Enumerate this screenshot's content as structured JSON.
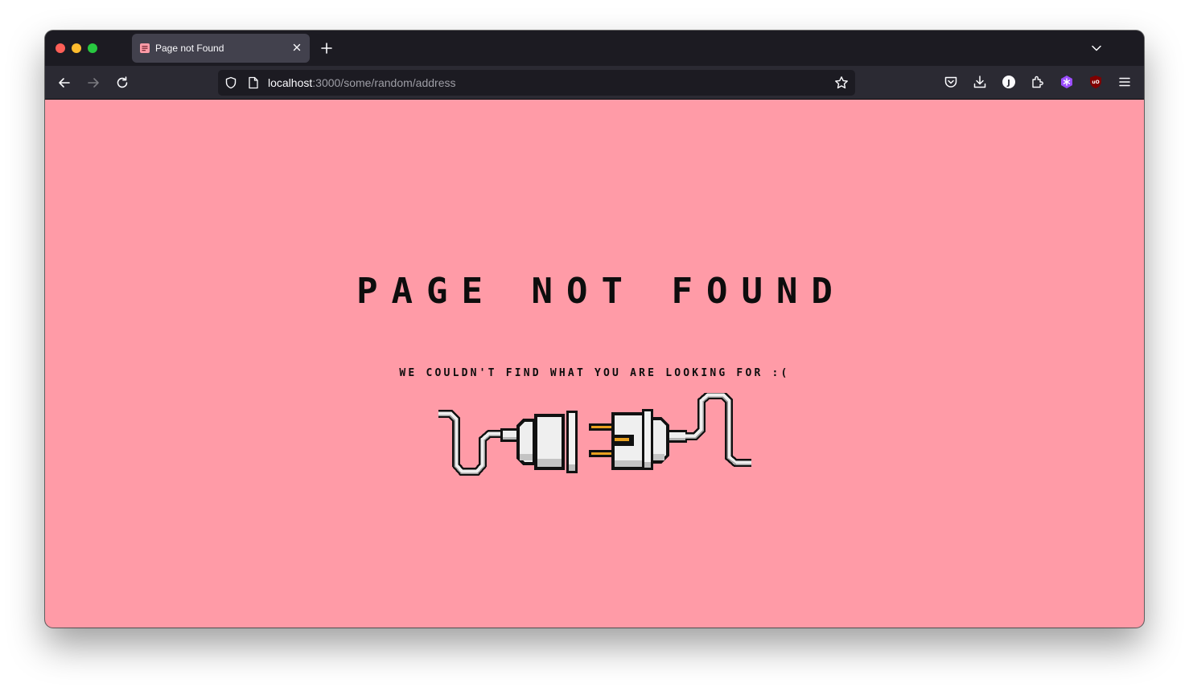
{
  "browser": {
    "tab": {
      "title": "Page not Found"
    },
    "url": {
      "host": "localhost",
      "path": ":3000/some/random/address"
    },
    "profile_initial": "J",
    "ublock_badge": "uO"
  },
  "page": {
    "title": "PAGE NOT FOUND",
    "message": "WE COULDN'T FIND WHAT YOU ARE LOOKING FOR :(",
    "background_color": "#ff9ba7",
    "illustration": "unplugged-cable-plug-and-socket"
  }
}
